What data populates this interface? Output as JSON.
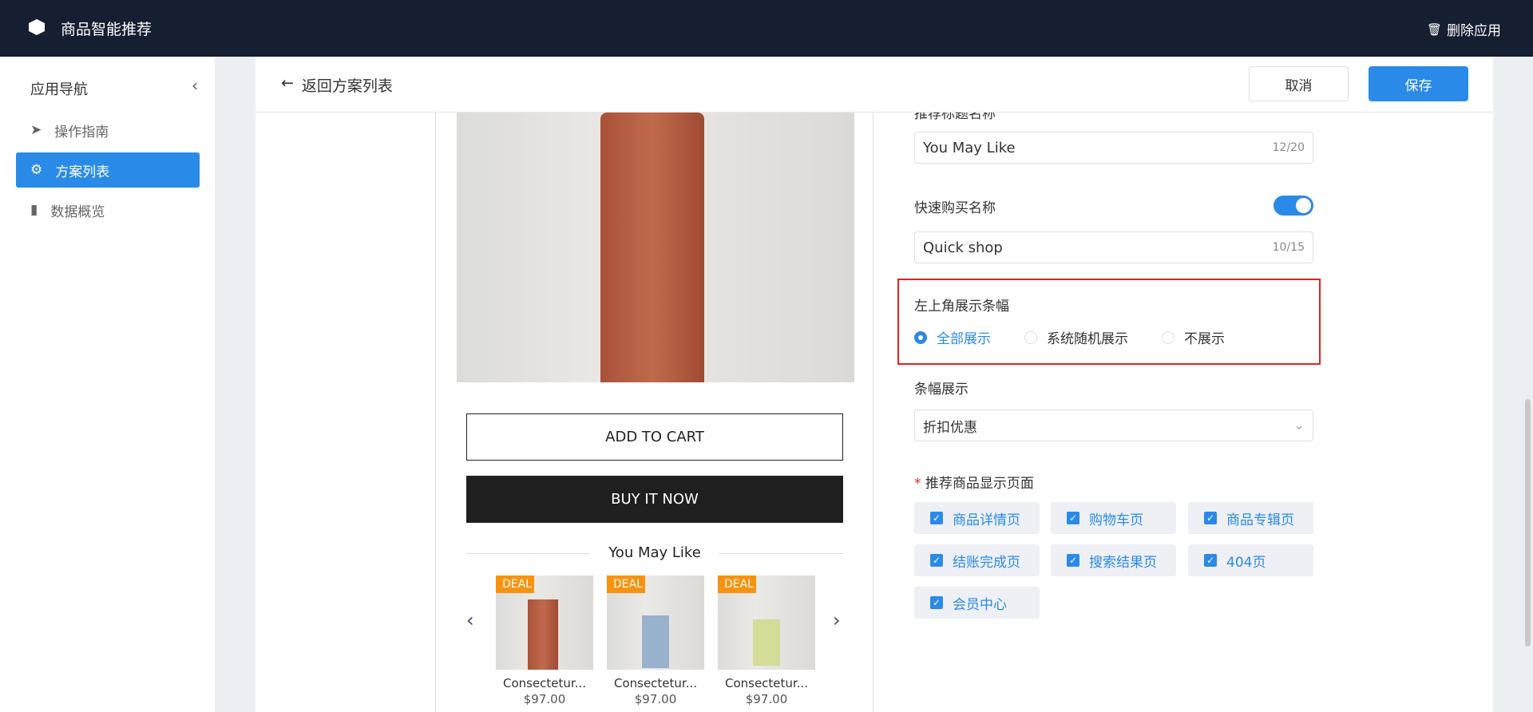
{
  "header": {
    "app_title": "商品智能推荐",
    "delete_label": "删除应用"
  },
  "sidebar": {
    "title": "应用导航",
    "items": [
      {
        "label": "操作指南",
        "icon": "send-icon"
      },
      {
        "label": "方案列表",
        "icon": "gear-icon",
        "active": true
      },
      {
        "label": "数据概览",
        "icon": "bar-chart-icon"
      }
    ]
  },
  "topbar": {
    "back_label": "返回方案列表",
    "cancel_label": "取消",
    "save_label": "保存"
  },
  "preview": {
    "add_to_cart": "ADD TO CART",
    "buy_now": "BUY IT NOW",
    "section_title": "You May Like",
    "products": [
      {
        "badge": "DEAL",
        "title": "Consectetur...",
        "price": "$97.00"
      },
      {
        "badge": "DEAL",
        "title": "Consectetur...",
        "price": "$97.00"
      },
      {
        "badge": "DEAL",
        "title": "Consectetur...",
        "price": "$97.00"
      }
    ]
  },
  "form": {
    "title_label": "推荐标题名称",
    "title_value": "You May Like",
    "title_count": "12/20",
    "quick_label": "快速购买名称",
    "quick_enabled": true,
    "quick_value": "Quick shop",
    "quick_count": "10/15",
    "banner_corner_label": "左上角展示条幅",
    "banner_corner_options": [
      "全部展示",
      "系统随机展示",
      "不展示"
    ],
    "banner_corner_selected": "全部展示",
    "banner_label": "条幅展示",
    "banner_value": "折扣优惠",
    "pages_label": "推荐商品显示页面",
    "pages_required": "*",
    "pages": [
      "商品详情页",
      "购物车页",
      "商品专辑页",
      "结账完成页",
      "搜索结果页",
      "404页",
      "会员中心"
    ]
  },
  "colors": {
    "accent": "#2a8ae8",
    "header": "#161e31",
    "deal": "#f7930f",
    "highlight": "#e52222"
  }
}
